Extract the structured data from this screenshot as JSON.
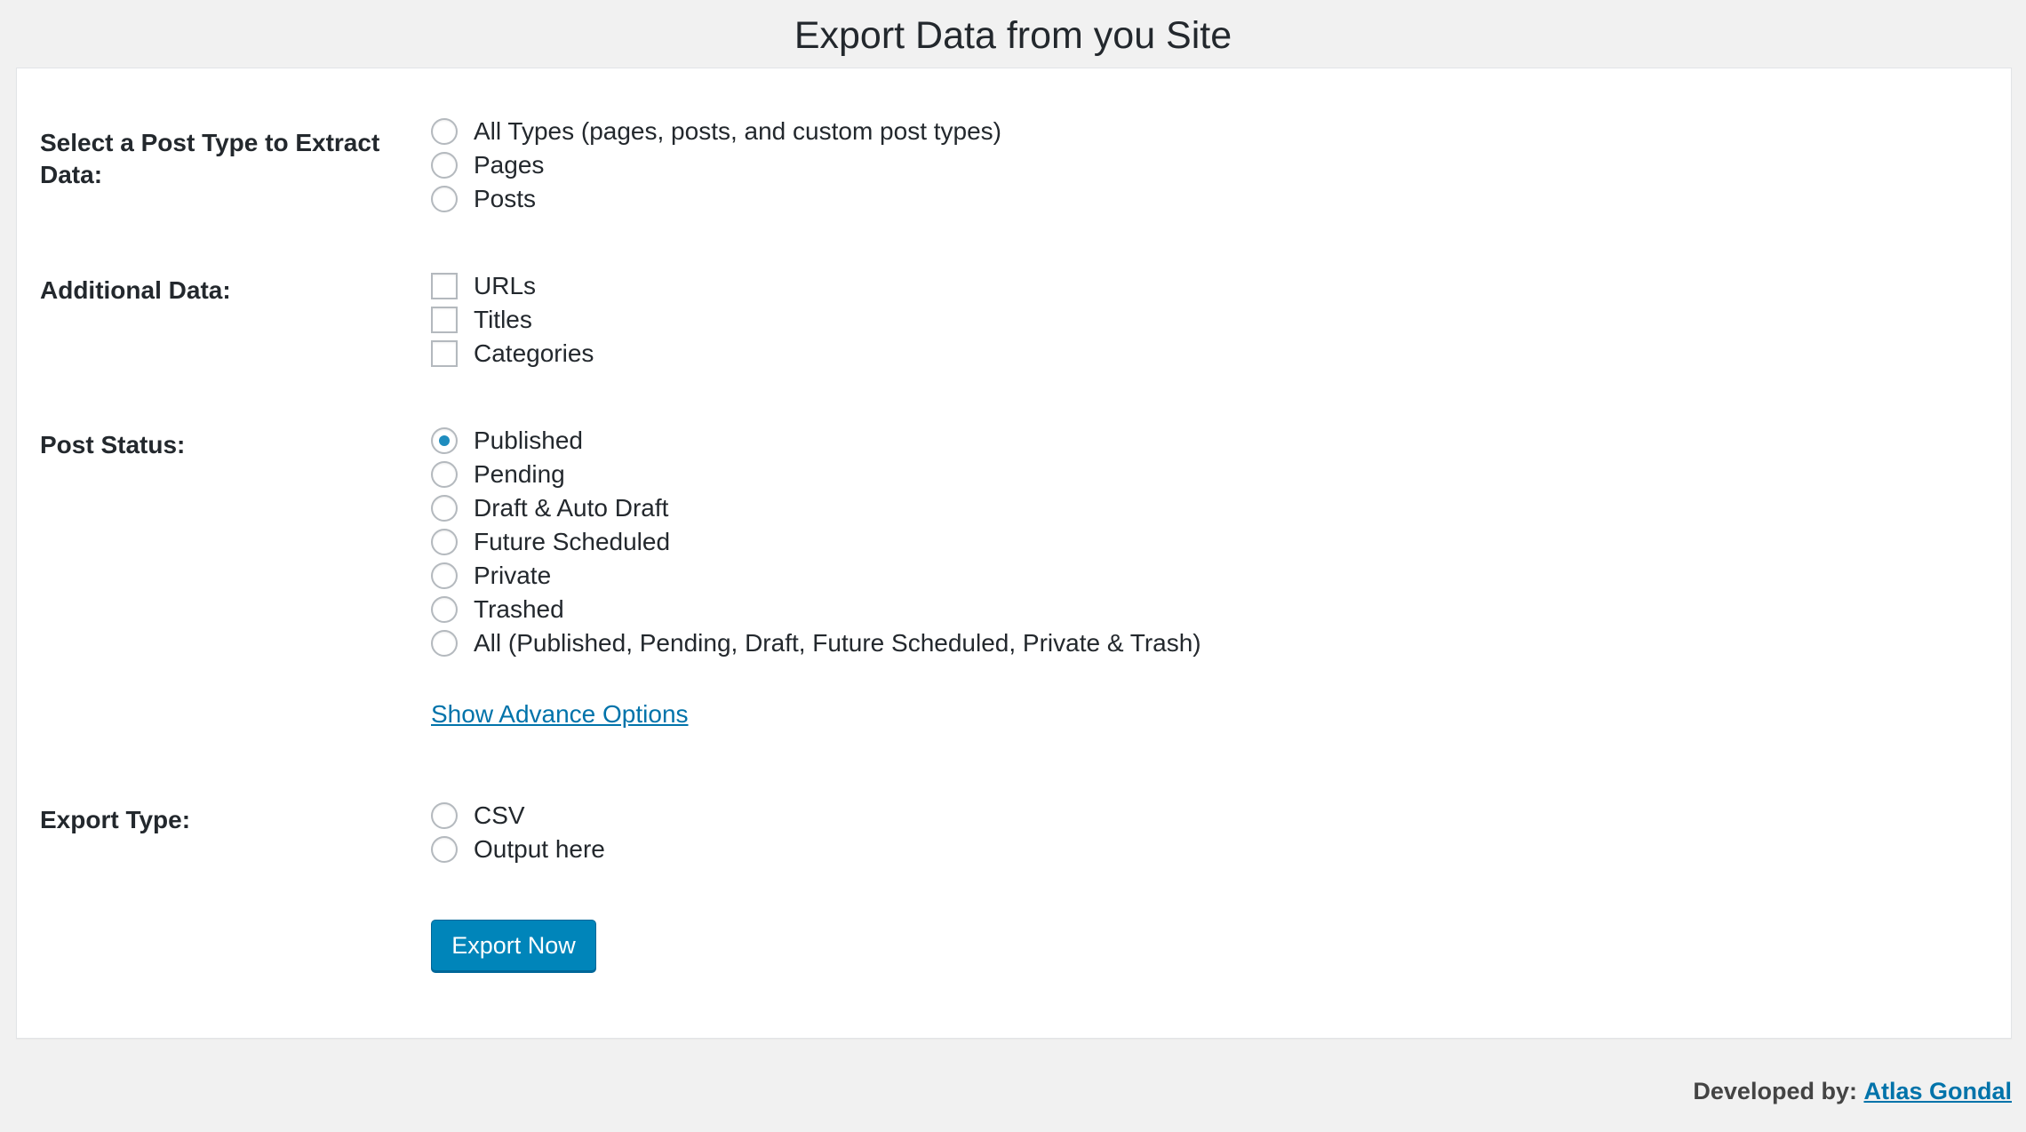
{
  "page": {
    "title": "Export Data from you Site"
  },
  "post_type": {
    "label": "Select a Post Type to Extract Data:",
    "options": [
      {
        "label": "All Types (pages, posts, and custom post types)",
        "checked": false
      },
      {
        "label": "Pages",
        "checked": false
      },
      {
        "label": "Posts",
        "checked": false
      }
    ]
  },
  "additional_data": {
    "label": "Additional Data:",
    "options": [
      {
        "label": "URLs",
        "checked": false
      },
      {
        "label": "Titles",
        "checked": false
      },
      {
        "label": "Categories",
        "checked": false
      }
    ]
  },
  "post_status": {
    "label": "Post Status:",
    "options": [
      {
        "label": "Published",
        "checked": true
      },
      {
        "label": "Pending",
        "checked": false
      },
      {
        "label": "Draft & Auto Draft",
        "checked": false
      },
      {
        "label": "Future Scheduled",
        "checked": false
      },
      {
        "label": "Private",
        "checked": false
      },
      {
        "label": "Trashed",
        "checked": false
      },
      {
        "label": "All (Published, Pending, Draft, Future Scheduled, Private & Trash)",
        "checked": false
      }
    ]
  },
  "advance": {
    "link_label": "Show Advance Options"
  },
  "export_type": {
    "label": "Export Type:",
    "options": [
      {
        "label": "CSV",
        "checked": false
      },
      {
        "label": "Output here",
        "checked": false
      }
    ]
  },
  "actions": {
    "export_label": "Export Now"
  },
  "footer": {
    "prefix": "Developed by:",
    "author": "Atlas Gondal"
  },
  "colors": {
    "accent": "#0085ba",
    "link": "#0073aa",
    "radio_dot": "#1e8cbe",
    "background": "#f1f1f1"
  }
}
